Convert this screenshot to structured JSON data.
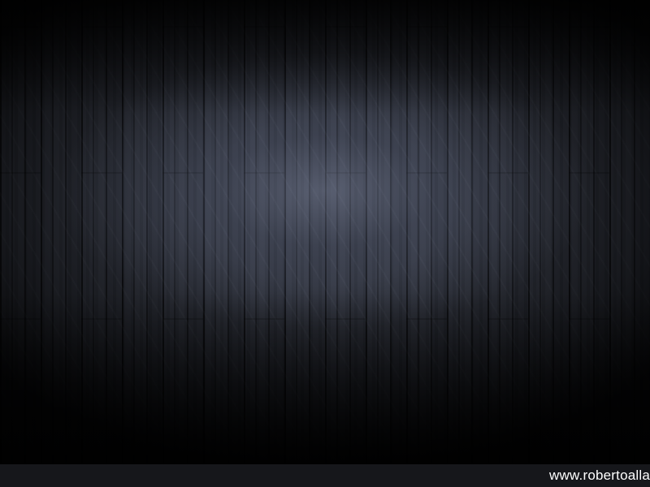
{
  "background": {
    "subject": "dark-wood-plank-wallpaper",
    "base_color": "#272a33",
    "highlight_color": "#9aa2be"
  },
  "footer": {
    "site_text": "www.robertoalla"
  }
}
